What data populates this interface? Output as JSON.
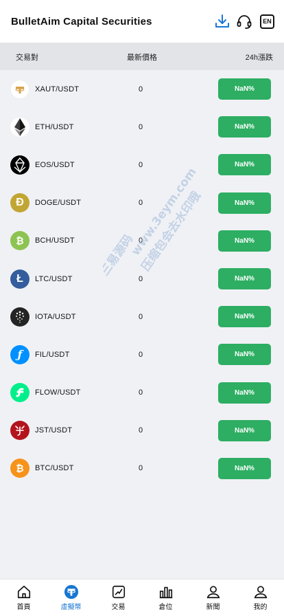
{
  "header": {
    "title": "BulletAim Capital Securities",
    "icons": [
      "download-icon",
      "headset-icon"
    ],
    "lang_label": "EN"
  },
  "table": {
    "col_pair": "交易對",
    "col_price": "最新價格",
    "col_change": "24h漲跌"
  },
  "rows": [
    {
      "pair": "XAUT/USDT",
      "price": "0",
      "change": "NaN%",
      "icon": "xaut-icon",
      "color": "#ffffff"
    },
    {
      "pair": "ETH/USDT",
      "price": "0",
      "change": "NaN%",
      "icon": "eth-icon",
      "color": "#ffffff"
    },
    {
      "pair": "EOS/USDT",
      "price": "0",
      "change": "NaN%",
      "icon": "eos-icon",
      "color": "#000000"
    },
    {
      "pair": "DOGE/USDT",
      "price": "0",
      "change": "NaN%",
      "icon": "doge-icon",
      "color": "#c2a633"
    },
    {
      "pair": "BCH/USDT",
      "price": "0",
      "change": "NaN%",
      "icon": "bch-icon",
      "color": "#8dc351"
    },
    {
      "pair": "LTC/USDT",
      "price": "0",
      "change": "NaN%",
      "icon": "ltc-icon",
      "color": "#345d9d"
    },
    {
      "pair": "IOTA/USDT",
      "price": "0",
      "change": "NaN%",
      "icon": "iota-icon",
      "color": "#242424"
    },
    {
      "pair": "FIL/USDT",
      "price": "0",
      "change": "NaN%",
      "icon": "fil-icon",
      "color": "#0090ff"
    },
    {
      "pair": "FLOW/USDT",
      "price": "0",
      "change": "NaN%",
      "icon": "flow-icon",
      "color": "#00ef8b"
    },
    {
      "pair": "JST/USDT",
      "price": "0",
      "change": "NaN%",
      "icon": "jst-icon",
      "color": "#b3131b"
    },
    {
      "pair": "BTC/USDT",
      "price": "0",
      "change": "NaN%",
      "icon": "btc-icon",
      "color": "#f7931a"
    }
  ],
  "watermark": {
    "line1": "www.3eym.com",
    "line2": "三易源码",
    "line3": "压缩包会去水印哦"
  },
  "nav": [
    {
      "label": "首頁",
      "icon": "home-icon"
    },
    {
      "label": "虛擬幣",
      "icon": "tether-icon",
      "active": true
    },
    {
      "label": "交易",
      "icon": "trade-chart-icon"
    },
    {
      "label": "倉位",
      "icon": "bar-chart-icon"
    },
    {
      "label": "新聞",
      "icon": "user-news-icon"
    },
    {
      "label": "我的",
      "icon": "profile-icon"
    }
  ],
  "colors": {
    "accent": "#1976d2",
    "positive": "#2dae62",
    "header_bg": "#e3e4e8",
    "page_bg": "#f0f1f5"
  }
}
